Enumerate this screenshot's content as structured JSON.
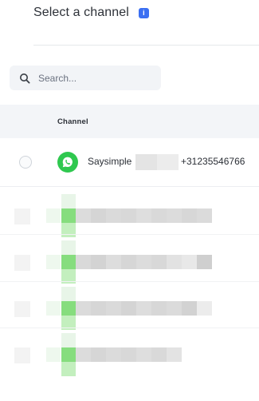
{
  "header": {
    "title": "Select a channel",
    "info_icon": "info-icon"
  },
  "search": {
    "placeholder": "Search...",
    "icon": "search-icon"
  },
  "table": {
    "columns": [
      "Channel"
    ],
    "rows": [
      {
        "name": "Saysimple",
        "phone": "+31235546766",
        "icon": "whatsapp-icon"
      }
    ]
  },
  "colors": {
    "accent": "#3b6ff2",
    "whatsapp": "#2fc84f",
    "header_bg": "#f3f5f8"
  }
}
